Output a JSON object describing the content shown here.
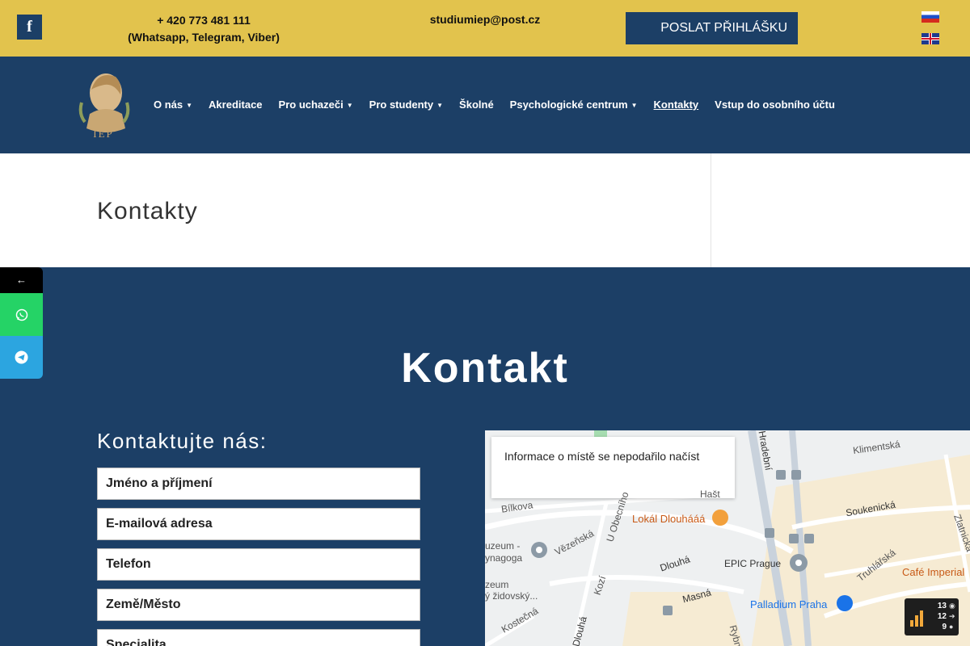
{
  "topbar": {
    "facebook_icon": "facebook-icon",
    "phone": "+ 420 773 481 111",
    "phone_apps": "(Whatsapp, Telegram, Viber)",
    "email": "studiumiep@post.cz",
    "apply_label": "POSLAT PŘIHLÁŠKU",
    "colors": {
      "bar": "#e2c34d",
      "primary": "#1c3f66"
    }
  },
  "logo": {
    "text": "IEP"
  },
  "nav": {
    "items": [
      {
        "label": "O nás",
        "dropdown": true
      },
      {
        "label": "Akreditace",
        "dropdown": false
      },
      {
        "label": "Pro uchazeči",
        "dropdown": true
      },
      {
        "label": "Pro studenty",
        "dropdown": true
      },
      {
        "label": "Školné",
        "dropdown": false
      },
      {
        "label": "Psychologické centrum",
        "dropdown": true
      },
      {
        "label": "Kontakty",
        "dropdown": false,
        "active": true
      },
      {
        "label": "Vstup do osobního účtu",
        "dropdown": false
      }
    ]
  },
  "page": {
    "title": "Kontakty"
  },
  "side_social": {
    "back": "←",
    "whatsapp_icon": "whatsapp-icon",
    "telegram_icon": "telegram-icon"
  },
  "content": {
    "heading": "Kontakt",
    "subheading": "Kontaktujte nás:",
    "form": {
      "name_placeholder": "Jméno a příjmení",
      "email_placeholder": "E-mailová adresa",
      "phone_placeholder": "Telefon",
      "city_placeholder": "Země/Město",
      "specialty_placeholder": "Specialita"
    }
  },
  "map": {
    "info": "Informace o místě se nepodařilo načíst",
    "labels": {
      "klimentska": "Klimentská",
      "hradebni": "Hradební",
      "bilkova": "Bílkova",
      "soukenicka": "Soukenická",
      "lokal": "Lokál Dlouhááá",
      "muzeum1": "uzeum -",
      "synagoga": "ynagoga",
      "vezenska": "Vězeňská",
      "dlouha": "Dlouhá",
      "epic": "EPIC Prague",
      "truhlarska": "Truhlářská",
      "cafe": "Café Imperial",
      "muzeum2": "zeum",
      "zidovsky": "ý židovský...",
      "kozi": "Kozí",
      "masna": "Masná",
      "palladium": "Palladium Praha",
      "kostecna": "Kostečná",
      "dlouha2": "Dlouhá",
      "zlatnicka": "Zlatnická",
      "obecni": "U Obecního",
      "rybna": "Rybn",
      "haste": "Hašt"
    }
  },
  "widget": {
    "views": "13",
    "visits": "12",
    "visitors": "9"
  }
}
